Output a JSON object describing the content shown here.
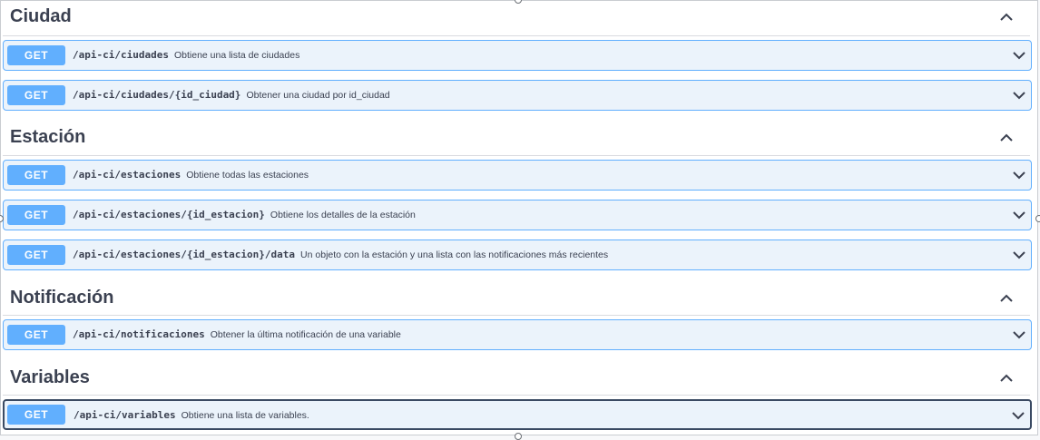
{
  "sections": [
    {
      "title": "Ciudad",
      "operations": [
        {
          "method": "GET",
          "path": "/api-ci/ciudades",
          "summary": "Obtiene una lista de ciudades"
        },
        {
          "method": "GET",
          "path": "/api-ci/ciudades/{id_ciudad}",
          "summary": "Obtener una ciudad por id_ciudad"
        }
      ]
    },
    {
      "title": "Estación",
      "operations": [
        {
          "method": "GET",
          "path": "/api-ci/estaciones",
          "summary": "Obtiene todas las estaciones"
        },
        {
          "method": "GET",
          "path": "/api-ci/estaciones/{id_estacion}",
          "summary": "Obtiene los detalles de la estación"
        },
        {
          "method": "GET",
          "path": "/api-ci/estaciones/{id_estacion}/data",
          "summary": "Un objeto con la estación y una lista con las notificaciones más recientes"
        }
      ]
    },
    {
      "title": "Notificación",
      "operations": [
        {
          "method": "GET",
          "path": "/api-ci/notificaciones",
          "summary": "Obtener la última notificación de una variable"
        }
      ]
    },
    {
      "title": "Variables",
      "operations": [
        {
          "method": "GET",
          "path": "/api-ci/variables",
          "summary": "Obtiene una lista de variables."
        }
      ]
    }
  ],
  "icons": {
    "section_toggle": "chevron-up-icon",
    "operation_toggle": "chevron-down-icon"
  },
  "colors": {
    "get_method": "#61affe",
    "operation_background": "#ebf3fb",
    "text": "#3b4151"
  }
}
